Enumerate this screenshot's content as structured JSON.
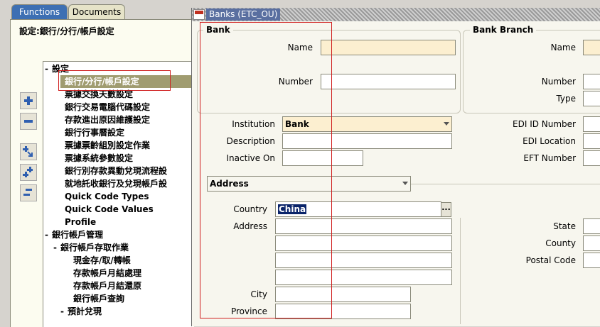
{
  "navigator": {
    "tabs": [
      {
        "label": "Functions",
        "active": true
      },
      {
        "label": "Documents",
        "active": false
      }
    ],
    "title": "設定:銀行/分行/帳戶設定",
    "tree": [
      {
        "label": "設定",
        "toggle": "-",
        "level": 0
      },
      {
        "label": "銀行/分行/帳戶設定",
        "toggle": "",
        "level": 1,
        "selected": true
      },
      {
        "label": "票據交換天數設定",
        "toggle": "",
        "level": 1
      },
      {
        "label": "銀行交易電腦代碼設定",
        "toggle": "",
        "level": 1
      },
      {
        "label": "存款進出原因維護設定",
        "toggle": "",
        "level": 1
      },
      {
        "label": "銀行行事曆設定",
        "toggle": "",
        "level": 1
      },
      {
        "label": "票據票齡組別設定作業",
        "toggle": "",
        "level": 1
      },
      {
        "label": "票據系統參數設定",
        "toggle": "",
        "level": 1
      },
      {
        "label": "銀行別存款異動兌現流程設",
        "toggle": "",
        "level": 1
      },
      {
        "label": "就地託收銀行及兌現帳戶設",
        "toggle": "",
        "level": 1
      },
      {
        "label": "Quick Code Types",
        "toggle": "",
        "level": 1
      },
      {
        "label": "Quick Code Values",
        "toggle": "",
        "level": 1
      },
      {
        "label": "Profile",
        "toggle": "",
        "level": 1
      },
      {
        "label": "銀行帳戶管理",
        "toggle": "-",
        "level": 0
      },
      {
        "label": "銀行帳戶存取作業",
        "toggle": "-",
        "level": 1
      },
      {
        "label": "現金存/取/轉帳",
        "toggle": "",
        "level": 2
      },
      {
        "label": "存款帳戶月結處理",
        "toggle": "",
        "level": 2
      },
      {
        "label": "存款帳戶月結還原",
        "toggle": "",
        "level": 2
      },
      {
        "label": "銀行帳戶查詢",
        "toggle": "",
        "level": 2
      },
      {
        "label": "預計兌現",
        "toggle": "-",
        "level": 1
      }
    ],
    "side_buttons": [
      "add-icon",
      "remove-icon",
      "expand-branch-icon",
      "expand-all-icon",
      "collapse-all-icon"
    ]
  },
  "window": {
    "title": "Banks (ETC_OU)"
  },
  "bank_group": {
    "title": "Bank",
    "name_label": "Name",
    "name_value": "",
    "number_label": "Number",
    "number_value": ""
  },
  "branch_group": {
    "title": "Bank Branch",
    "name_label": "Name",
    "number_label": "Number",
    "type_label": "Type"
  },
  "fields": {
    "institution_label": "Institution",
    "institution_value": "Bank",
    "description_label": "Description",
    "description_value": "",
    "inactive_on_label": "Inactive On",
    "inactive_on_value": "",
    "edi_id_label": "EDI ID Number",
    "edi_location_label": "EDI Location",
    "eft_label": "EFT Number"
  },
  "address_section": {
    "selector_value": "Address",
    "country_label": "Country",
    "country_value": "China",
    "lov_label": "...",
    "address_label": "Address",
    "city_label": "City",
    "province_label": "Province",
    "state_label": "State",
    "county_label": "County",
    "postal_code_label": "Postal Code"
  }
}
